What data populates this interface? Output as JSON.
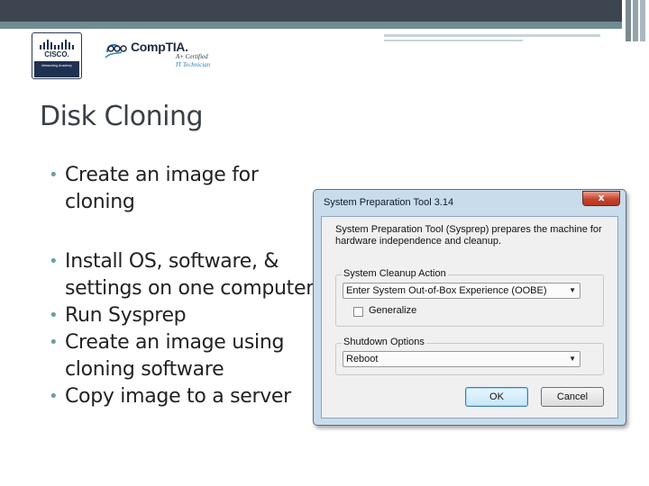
{
  "slide": {
    "title": "Disk Cloning",
    "bullets": [
      "Create an image for cloning",
      "Install OS, software, & settings on one computer",
      "Run Sysprep",
      "Create an image using cloning software",
      "Copy image to a server"
    ]
  },
  "logos": {
    "cisco": {
      "word": "CISCO.",
      "band_text": "Networking Academy"
    },
    "comptia": {
      "word": "CompTIA.",
      "sub_line1": "A+ Certified",
      "sub_line2": "IT Technician"
    }
  },
  "dialog": {
    "title": "System Preparation Tool 3.14",
    "close_label": "x",
    "description": "System Preparation Tool (Sysprep) prepares the machine for hardware independence and cleanup.",
    "cleanup": {
      "label": "System Cleanup Action",
      "selected": "Enter System Out-of-Box Experience (OOBE)",
      "generalize_label": "Generalize"
    },
    "shutdown": {
      "label": "Shutdown Options",
      "selected": "Reboot"
    },
    "ok_label": "OK",
    "cancel_label": "Cancel"
  },
  "colors": {
    "top_bar": "#3d4550",
    "accent": "#6f8c91",
    "bullet": "#6f9ea6",
    "dialog_frame": "#c8dcec"
  },
  "icons": {
    "dropdown_arrow": "chevron-down-icon",
    "close": "close-icon"
  }
}
